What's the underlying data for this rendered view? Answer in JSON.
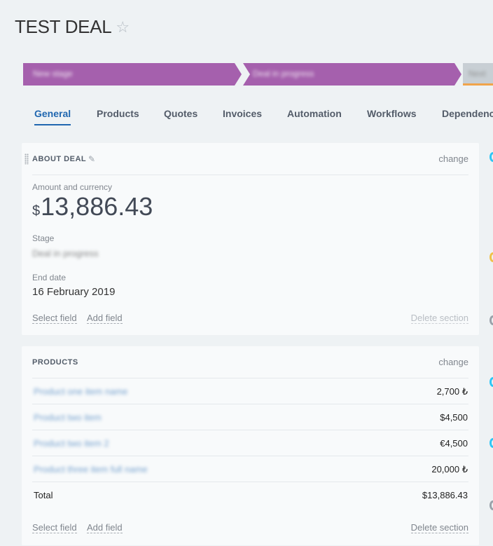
{
  "header": {
    "title": "TEST DEAL",
    "star_icon": "☆"
  },
  "pipeline": {
    "stages": [
      {
        "label": "New stage",
        "color": "#a560ad"
      },
      {
        "label": "Deal in progress",
        "color": "#a560ad"
      },
      {
        "label": "Next",
        "color": "#c8cfd4"
      }
    ]
  },
  "tabs": [
    "General",
    "Products",
    "Quotes",
    "Invoices",
    "Automation",
    "Workflows",
    "Dependencies"
  ],
  "active_tab": "General",
  "about": {
    "section_title": "ABOUT DEAL",
    "change_label": "change",
    "amount_label": "Amount and currency",
    "currency_symbol": "$",
    "amount": "13,886.43",
    "stage_label": "Stage",
    "stage_value": "Deal in progress",
    "end_date_label": "End date",
    "end_date_value": "16 February 2019",
    "select_field": "Select field",
    "add_field": "Add field",
    "delete_section": "Delete section"
  },
  "products": {
    "section_title": "PRODUCTS",
    "change_label": "change",
    "rows": [
      {
        "name": "Product one item name",
        "price": "2,700 ₺"
      },
      {
        "name": "Product two item",
        "price": "$4,500"
      },
      {
        "name": "Product two item 2",
        "price": "€4,500"
      },
      {
        "name": "Product three item full name",
        "price": "20,000 ₺"
      }
    ],
    "total_label": "Total",
    "total_value": "$13,886.43",
    "select_field": "Select field",
    "add_field": "Add field",
    "delete_section": "Delete section"
  },
  "colors": {
    "accent": "#2067b0",
    "stage": "#a560ad",
    "background": "#eef2f4"
  }
}
